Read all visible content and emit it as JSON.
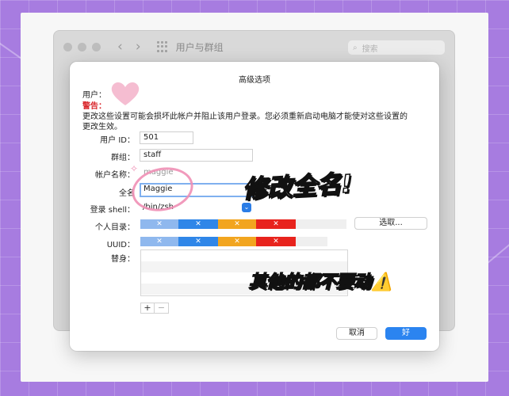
{
  "back_window": {
    "title": "用户与群组",
    "search_placeholder": "搜索"
  },
  "dialog": {
    "title": "高级选项",
    "user_label": "用户：",
    "warning_label": "警告：",
    "warning_text": "更改这些设置可能会损坏此帐户并阻止该用户登录。您必须重新启动电脑才能使对这些设置的更改生效。",
    "fields": {
      "user_id": {
        "label": "用户 ID：",
        "value": "501"
      },
      "group": {
        "label": "群组：",
        "value": "staff"
      },
      "account_name": {
        "label": "帐户名称：",
        "value": "maggie"
      },
      "full_name": {
        "label": "全名",
        "value": "Maggie"
      },
      "login_shell": {
        "label": "登录 shell：",
        "value": "/bin/zsh"
      },
      "home_dir": {
        "label": "个人目录：",
        "choose_button": "选取..."
      },
      "uuid": {
        "label": "UUID："
      },
      "aliases": {
        "label": "替身："
      }
    },
    "add_button": "+",
    "remove_button": "−",
    "cancel_button": "取消",
    "ok_button": "好"
  },
  "annotations": {
    "edit_fullname": "修改全名!",
    "dont_touch": "其他的都不要动",
    "warning_emoji": "⚠️"
  },
  "colors": {
    "redact_blue_light": "#8fb8ee",
    "redact_blue": "#2f86e8",
    "redact_orange": "#f2a51f",
    "redact_red": "#e8231d",
    "accent": "#2b84f0"
  }
}
